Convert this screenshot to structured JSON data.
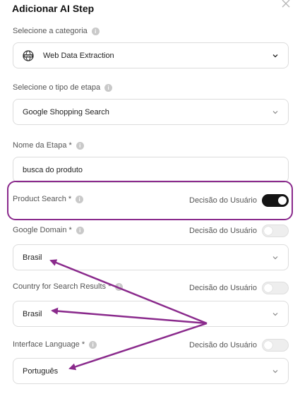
{
  "dialog": {
    "title": "Adicionar AI Step"
  },
  "category": {
    "label": "Selecione a categoria",
    "value": "Web Data Extraction",
    "icon": "globe-www-icon"
  },
  "step_type": {
    "label": "Selecione o tipo de etapa",
    "value": "Google Shopping Search"
  },
  "step_name": {
    "label": "Nome da Etapa *",
    "value": "busca do produto"
  },
  "product_search": {
    "label": "Product Search *",
    "toggle_label": "Decisão do Usuário",
    "toggle_on": true
  },
  "google_domain": {
    "label": "Google Domain *",
    "toggle_label": "Decisão do Usuário",
    "toggle_on": false,
    "value": "Brasil"
  },
  "country": {
    "label": "Country for Search Results *",
    "toggle_label": "Decisão do Usuário",
    "toggle_on": false,
    "value": "Brasil"
  },
  "language": {
    "label": "Interface Language *",
    "toggle_label": "Decisão do Usuário",
    "toggle_on": false,
    "value": "Português"
  },
  "colors": {
    "accent": "#8a2a8c",
    "toggle_on": "#141414"
  }
}
